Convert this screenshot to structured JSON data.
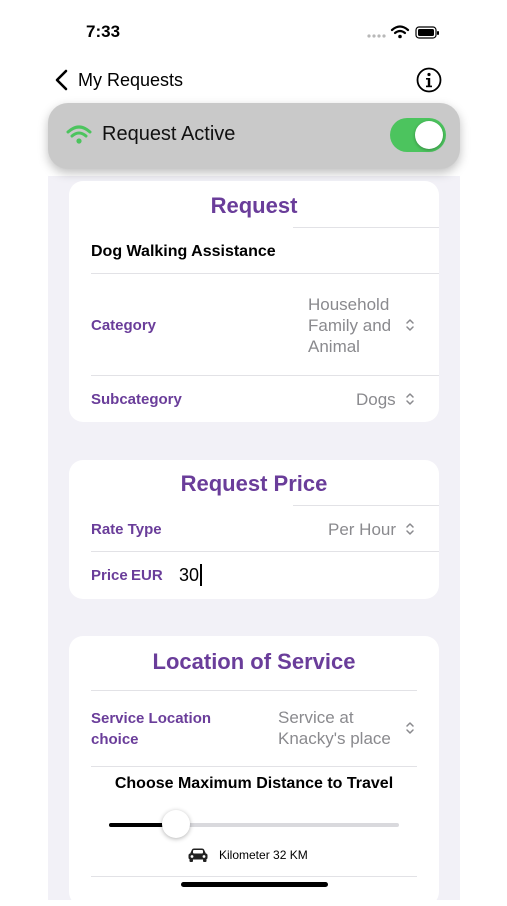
{
  "status": {
    "time": "7:33"
  },
  "nav": {
    "back_label": "My Requests"
  },
  "active": {
    "label": "Request Active",
    "enabled": true
  },
  "request_card": {
    "title": "Request",
    "request_name": "Dog Walking Assistance",
    "category_label": "Category",
    "category_value_line1": "Household",
    "category_value_line2": "Family and",
    "category_value_line3": "Animal",
    "subcategory_label": "Subcategory",
    "subcategory_value": "Dogs"
  },
  "price_card": {
    "title": "Request Price",
    "rate_type_label": "Rate Type",
    "rate_type_value": "Per Hour",
    "price_label": "Price",
    "currency": "EUR",
    "price_value": "30"
  },
  "location_card": {
    "title": "Location of Service",
    "service_location_label_line1": "Service Location",
    "service_location_label_line2": "choice",
    "service_location_value_line1": "Service at",
    "service_location_value_line2": "Knacky's place",
    "distance_title": "Choose Maximum Distance to Travel",
    "distance_text": "Kilometer 32 KM",
    "distance_fraction": 0.23
  },
  "colors": {
    "accent": "#6a3d9a",
    "toggle_on": "#4cc45e",
    "wifi_green": "#4cc45e",
    "muted_text": "#8a8a8e",
    "grouped_bg": "#f2f1f7"
  },
  "icons": {
    "back": "chevron-left-icon",
    "info": "info-circle-icon",
    "wifi": "wifi-icon",
    "chevron": "chevron-up-down-icon",
    "car": "car-icon"
  }
}
